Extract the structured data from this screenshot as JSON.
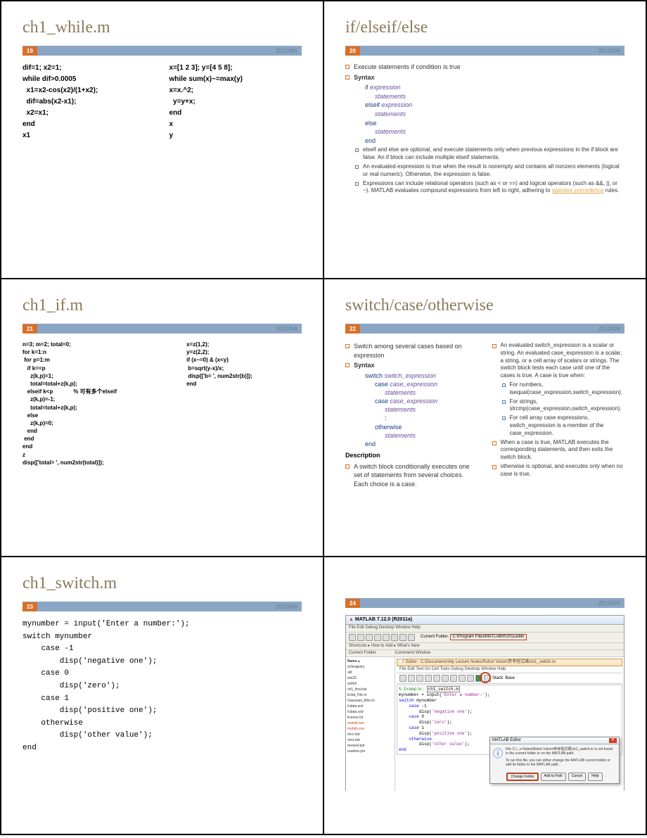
{
  "date": "2012/9/6",
  "slides": {
    "s19": {
      "page": "19",
      "title": "ch1_while.m",
      "left": [
        "dif=1; x2=1;",
        "while dif>0.0005",
        "  x1=x2-cos(x2)/(1+x2);",
        "  dif=abs(x2-x1);",
        "  x2=x1;",
        "end",
        "x1"
      ],
      "right": [
        "x=[1 2 3]; y=[4 5 8];",
        "while sum(x)~=max(y)",
        "x=x.^2;",
        "  y=y+x;",
        "end",
        "x",
        "y"
      ]
    },
    "s20": {
      "page": "20",
      "title": "if/elseif/else",
      "b1": "Execute statements if condition is true",
      "b2": "Syntax",
      "syntax": [
        "if expression",
        "statements",
        "elseif expression",
        "statements",
        "else",
        "statements",
        "end"
      ],
      "b3": "elseif and else are optional, and execute statements only when previous expressions in the if block are false. An if block can include multiple elseif statements.",
      "b4": "An evaluated expression is true when the result is nonempty and contains all nonzero elements (logical or real numeric). Otherwise, the expression is false.",
      "b5a": "Expressions can include relational operators (such as < or ==) and logical operators (such as &&, ||, or ~). MATLAB evaluates compound expressions from left to right, adhering to ",
      "b5link": "operator precedence",
      "b5b": " rules."
    },
    "s21": {
      "page": "21",
      "title": "ch1_if.m",
      "left": [
        "n=3; m=2; total=0;",
        "for k=1:n",
        " for p=1:m",
        "   if k==p",
        "     z(k,p)=1;",
        "     total=total+z(k,p);",
        "   elseif k<p             % 可有多个elseif",
        "     z(k,p)=-1;",
        "     total=total+z(k,p);",
        "   else",
        "     z(k,p)=0;",
        "   end",
        " end",
        "end",
        "z",
        "disp(['total= ', num2str(total)]);"
      ],
      "right": [
        "x=z(1,2);",
        "y=z(2,2);",
        "if (x~=0) & (x<y)",
        " b=sqrt(y-x)/x;",
        " disp(['b= ', num2str(b)]);",
        "end"
      ]
    },
    "s22": {
      "page": "22",
      "title": "switch/case/otherwise",
      "l1": "Switch among several cases based on expression",
      "l2": "Syntax",
      "syntax": [
        "switch switch_expression",
        "case case_expression",
        "statements",
        "case case_expression",
        "statements",
        ":",
        "otherwise",
        "statements",
        "end"
      ],
      "l3h": "Description",
      "l3": "A switch block conditionally executes one set of statements from several choices. Each choice is a case.",
      "r1": "An evaluated switch_expression is a scalar or string. An evaluated case_expression is a scalar, a string, or a cell array of scalars or strings. The switch block tests each case until one of the cases is true. A case is true when:",
      "r1a": "For numbers, isequal(case_expression,switch_expression).",
      "r1b": "For strings, strcmp(case_expression,switch_expression).",
      "r1c": "For cell array case expressions, switch_expression is a member of the case_expression.",
      "r2": "When a case is true, MATLAB executes the corresponding statements, and then exits the switch block.",
      "r3": "otherwise is optional, and executes only when no case is true."
    },
    "s23": {
      "page": "23",
      "title": "ch1_switch.m",
      "code": [
        "mynumber = input('Enter a number:');",
        "switch mynumber",
        "    case -1",
        "        disp('negative one');",
        "    case 0",
        "        disp('zero');",
        "    case 1",
        "        disp('positive one');",
        "    otherwise",
        "        disp('other value');",
        "end"
      ]
    },
    "s24": {
      "page": "24",
      "matlab_title": "MATLAB 7.12.0 (R2011a)",
      "menu": "File  Edit  Debug  Desktop  Window  Help",
      "cf_label": "Current Folder:",
      "cf_path": "C:\\Program Files\\MATLAB\\R2011a\\bin",
      "shortcuts": "Shortcuts  ▸ How to Add  ▸ What's New",
      "panel_cf": "Current Folder",
      "panel_cw": "Command Window",
      "side_items": [
        "Name ▴",
        "m3iregistry",
        "util",
        "win32",
        "win64",
        "ch1_first.bat",
        "Exlat_File.m",
        "Gaussian_filter.m",
        "lcdata.xml",
        "lcdata.xsd",
        "license.txt",
        "matlab.bat",
        "matlab.exe",
        "mcc.bat",
        "mex.bat",
        "mexext.bat",
        "readme.pm"
      ],
      "editor_title": "Editor - C:\\Documents\\My Lecture Notes\\Robot Vision\\参考程式碼\\ch1_switch.m",
      "editor_menu": "File  Edit  Text  Go  Cell  Tools  Debug  Desktop  Window  Help",
      "editor_stack": "Stack:  Base",
      "code_cmt": "% Example: ",
      "code_hl": "ch1_switch.m",
      "code_l1": "mynumber = input(",
      "code_s1": "'Enter a number:'",
      "code_l1b": ");",
      "code_l2": "switch",
      "code_l2b": " mynumber",
      "code_l3": "case",
      "code_l3b": " -1",
      "code_l4": "disp(",
      "code_s4": "'negative one'",
      "code_l4b": ");",
      "code_l5b": " 0",
      "code_s6": "'zero'",
      "code_l7b": " 1",
      "code_s8": "'positive one'",
      "code_l9": "otherwise",
      "code_s10": "'other value'",
      "code_l11": "end",
      "dlg_title": "MATLAB Editor",
      "dlg_text1": "File C:\\...e Notes\\Robot Vision\\参考程式碼\\ch1_switch.m is not found in the current folder or on the MATLAB path.",
      "dlg_text2": "To run this file, you can either change the MATLAB current folder or add its folder to the MATLAB path.",
      "dlg_btn1": "Change Folder",
      "dlg_btn2": "Add to Path",
      "dlg_btn3": "Cancel",
      "dlg_btn4": "Help"
    }
  }
}
